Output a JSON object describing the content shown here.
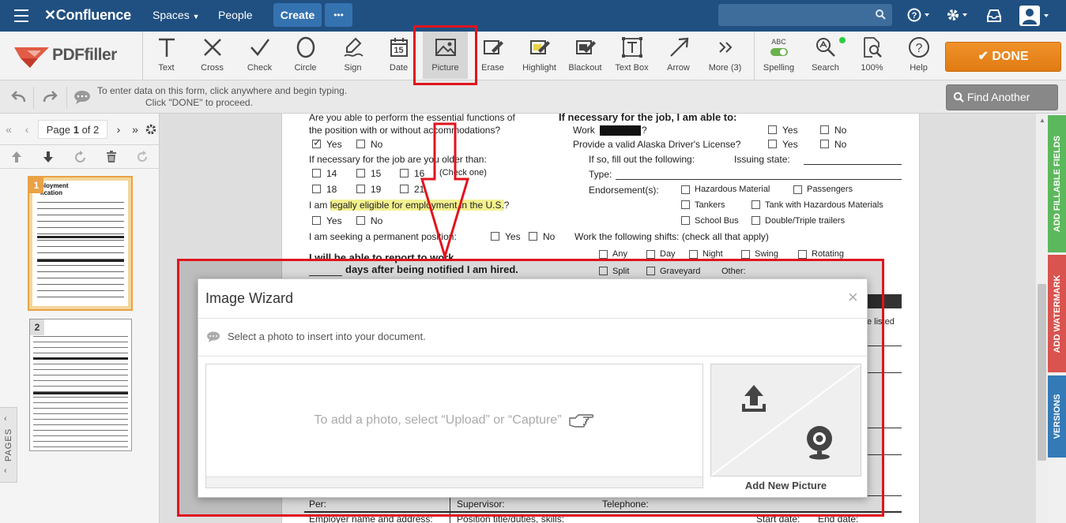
{
  "topnav": {
    "brand": "Confluence",
    "spaces": "Spaces",
    "people": "People",
    "create": "Create",
    "more": "•••"
  },
  "toolbar": {
    "logo": "PDFfiller",
    "tools": [
      {
        "label": "Text",
        "icon": "text-icon"
      },
      {
        "label": "Cross",
        "icon": "cross-icon"
      },
      {
        "label": "Check",
        "icon": "check-icon"
      },
      {
        "label": "Circle",
        "icon": "circle-icon"
      },
      {
        "label": "Sign",
        "icon": "sign-icon"
      },
      {
        "label": "Date",
        "icon": "date-icon"
      },
      {
        "label": "Picture",
        "icon": "picture-icon"
      },
      {
        "label": "Erase",
        "icon": "erase-icon"
      },
      {
        "label": "Highlight",
        "icon": "highlight-icon"
      },
      {
        "label": "Blackout",
        "icon": "blackout-icon"
      },
      {
        "label": "Text Box",
        "icon": "textbox-icon"
      },
      {
        "label": "Arrow",
        "icon": "arrow-icon"
      },
      {
        "label": "More (3)",
        "icon": "more-icon"
      },
      {
        "label": "Spelling",
        "icon": "spelling-icon"
      },
      {
        "label": "Search",
        "icon": "search-icon"
      },
      {
        "label": "100%",
        "icon": "zoom-icon"
      },
      {
        "label": "Help",
        "icon": "help-icon"
      }
    ],
    "date_glyph": "15",
    "spelling_abc": "ABC",
    "done": "DONE"
  },
  "subbar": {
    "hint_line1": "To enter data on this form, click anywhere and begin typing.",
    "hint_line2": "Click \"DONE\" to proceed.",
    "find_another": "Find Another Form"
  },
  "sidebar": {
    "page_label": "Page",
    "page_current": "1",
    "page_of": "of 2",
    "thumb1_num": "1",
    "thumb2_num": "2",
    "pages_tab": "PAGES"
  },
  "document": {
    "q1_line1": "Are you able to perform the essential functions of",
    "q1_line2": "the position with or without accommodations?",
    "yes": "Yes",
    "no": "No",
    "older_than": "If necessary for the job are you older than:",
    "age14": "14",
    "age15": "15",
    "age16": "16",
    "check_one": "(Check one)",
    "age18": "18",
    "age19": "19",
    "age21": "21",
    "legal_pre": "I am",
    "legal_hl": "legally eligible for employment in the U.S.",
    "legal_post": "?",
    "permanent": "I am seeking a permanent position:",
    "report": "I will be able to report to work",
    "days_after": "days after being notified I am hired.",
    "able_to": "If necessary for the job, I am able to:",
    "work": "Work",
    "work_q": "?",
    "drivers": "Provide a valid Alaska Driver's License?",
    "if_so": "If so, fill out the following:",
    "issuing": "Issuing state:",
    "type": "Type:",
    "endorsement": "Endorsement(s):",
    "hazmat": "Hazardous Material",
    "passengers": "Passengers",
    "tankers": "Tankers",
    "tank_haz": "Tank with Hazardous Materials",
    "school_bus": "School Bus",
    "double_triple": "Double/Triple trailers",
    "shifts": "Work the following shifts: (check all that apply)",
    "any": "Any",
    "day": "Day",
    "night": "Night",
    "swing": "Swing",
    "rotating": "Rotating",
    "split": "Split",
    "graveyard": "Graveyard",
    "other": "Other:",
    "e_listed": "e listed",
    "per": "Per:",
    "supervisor": "Supervisor:",
    "telephone": "Telephone:",
    "employer_name": "Employer name and address:",
    "position_title": "Position title/duties, skills:",
    "start_date": "Start date:",
    "end_date": "End date:"
  },
  "right_tabs": {
    "fillable": "ADD FILLABLE FIELDS",
    "watermark": "ADD WATERMARK",
    "versions": "VERSIONS"
  },
  "modal": {
    "title": "Image Wizard",
    "close": "×",
    "info": "Select a photo to insert into your document.",
    "dropzone": "To add a photo, select “Upload” or “Capture”",
    "add_new": "Add New Picture"
  },
  "colors": {
    "nav": "#205081",
    "create": "#3572b0",
    "done": "#e8841c",
    "highlight": "#f3f18f",
    "annotation": "#e0141e",
    "tab_green": "#5cb85c",
    "tab_red": "#d9534f",
    "tab_blue": "#337ab7"
  }
}
